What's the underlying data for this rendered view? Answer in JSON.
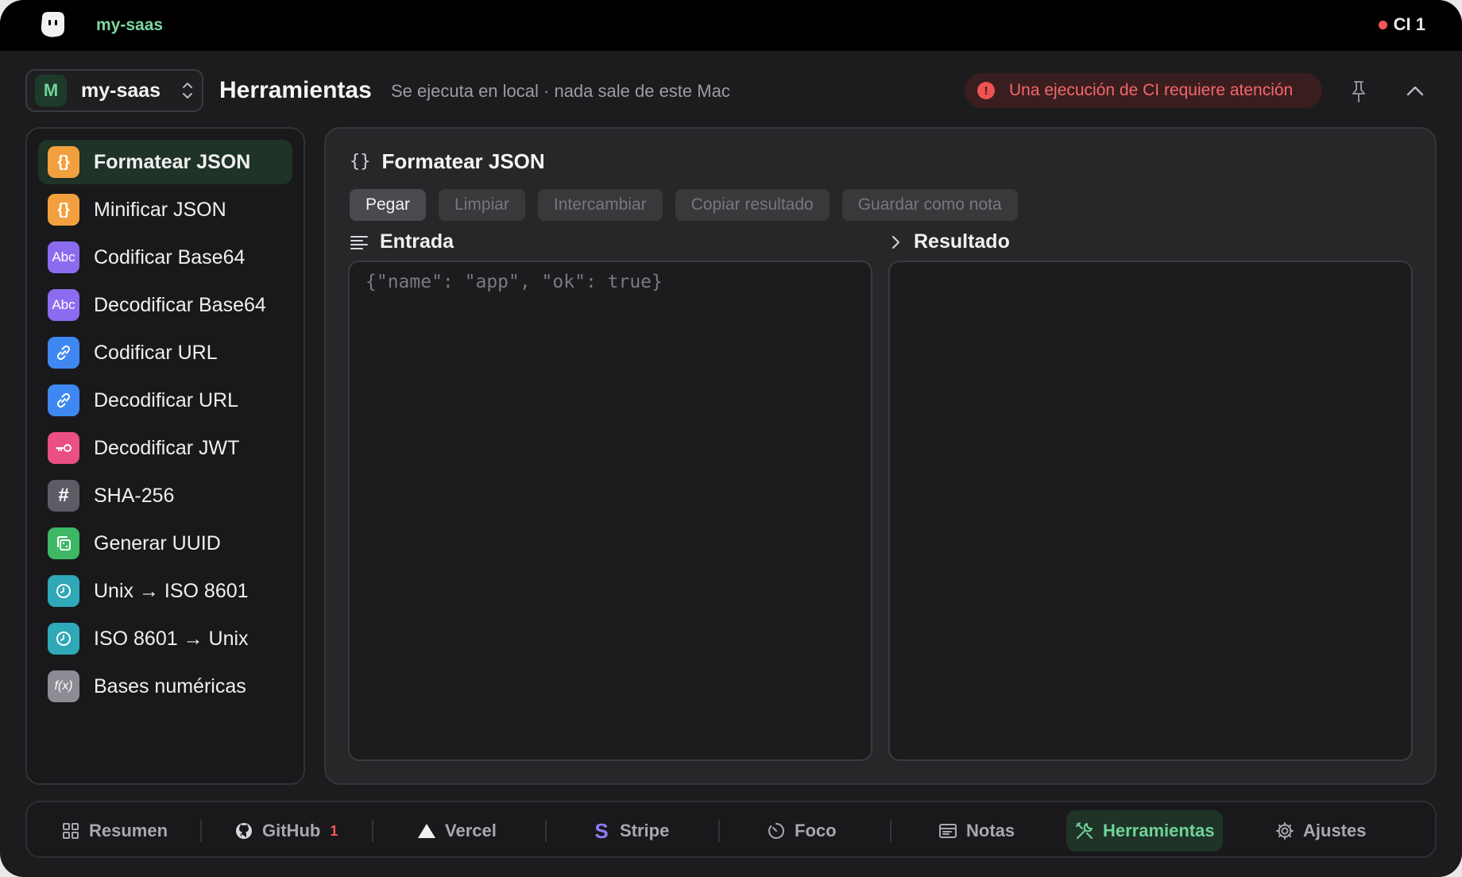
{
  "topbar": {
    "project": "my-saas",
    "ci_status": "CI 1"
  },
  "header": {
    "project_avatar": "M",
    "project_name": "my-saas",
    "title": "Herramientas",
    "subtitle": "Se ejecuta en local · nada sale de este Mac",
    "alert": "Una ejecución de CI requiere atención",
    "alert_icon": "!"
  },
  "sidebar": {
    "items": [
      {
        "label": "Formatear JSON",
        "icon": "braces-icon",
        "glyph": "{}",
        "color": "#f2a03d"
      },
      {
        "label": "Minificar JSON",
        "icon": "braces-icon",
        "glyph": "{}",
        "color": "#f2a03d"
      },
      {
        "label": "Codificar Base64",
        "icon": "text-abc-icon",
        "glyph": "Abc",
        "color": "#8b6cf0"
      },
      {
        "label": "Decodificar Base64",
        "icon": "text-abc-icon",
        "glyph": "Abc",
        "color": "#8b6cf0"
      },
      {
        "label": "Codificar URL",
        "icon": "link-icon",
        "glyph": "",
        "color": "#3f88f2"
      },
      {
        "label": "Decodificar URL",
        "icon": "link-icon",
        "glyph": "",
        "color": "#3f88f2"
      },
      {
        "label": "Decodificar JWT",
        "icon": "key-icon",
        "glyph": "",
        "color": "#ea4f86"
      },
      {
        "label": "SHA-256",
        "icon": "hash-icon",
        "glyph": "#",
        "color": "#5c5c64"
      },
      {
        "label": "Generar UUID",
        "icon": "dice-icon",
        "glyph": "",
        "color": "#3fb866"
      },
      {
        "label": "Unix → ISO 8601",
        "icon": "clock-icon",
        "glyph": "",
        "color": "#2fa8b8"
      },
      {
        "label": "ISO 8601 → Unix",
        "icon": "clock-icon",
        "glyph": "",
        "color": "#2fa8b8"
      },
      {
        "label": "Bases numéricas",
        "icon": "function-icon",
        "glyph": "f(x)",
        "color": "#8c8c94"
      }
    ]
  },
  "panel": {
    "title_glyph": "{}",
    "title": "Formatear JSON",
    "buttons": {
      "paste": "Pegar",
      "clear": "Limpiar",
      "swap": "Intercambiar",
      "copy": "Copiar resultado",
      "save": "Guardar como nota"
    },
    "input_label": "Entrada",
    "output_label": "Resultado",
    "input_placeholder": "{\"name\": \"app\", \"ok\": true}",
    "input_value": "",
    "output_value": ""
  },
  "bottomnav": {
    "items": [
      {
        "label": "Resumen",
        "icon": "grid-icon"
      },
      {
        "label": "GitHub",
        "icon": "github-icon",
        "badge": "1"
      },
      {
        "label": "Vercel",
        "icon": "triangle-icon"
      },
      {
        "label": "Stripe",
        "icon": "stripe-icon"
      },
      {
        "label": "Foco",
        "icon": "timer-icon"
      },
      {
        "label": "Notas",
        "icon": "note-icon"
      },
      {
        "label": "Herramientas",
        "icon": "tools-icon"
      },
      {
        "label": "Ajustes",
        "icon": "gear-icon"
      }
    ]
  },
  "colors": {
    "accent": "#6fd39a",
    "danger": "#f25757",
    "background": "#1c1c1e"
  }
}
